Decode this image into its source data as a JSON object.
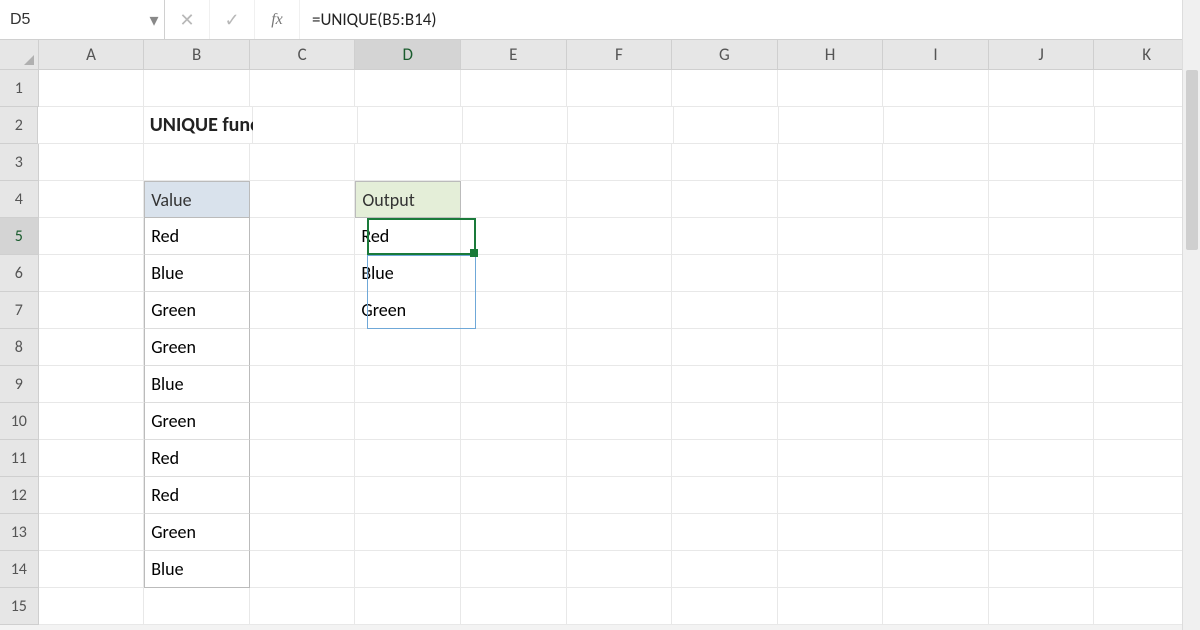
{
  "name_box": "D5",
  "formula": "=UNIQUE(B5:B14)",
  "columns": [
    "A",
    "B",
    "C",
    "D",
    "E",
    "F",
    "G",
    "H",
    "I",
    "J",
    "K"
  ],
  "active_col": "D",
  "active_row": 5,
  "row_numbers": [
    1,
    2,
    3,
    4,
    5,
    6,
    7,
    8,
    9,
    10,
    11,
    12,
    13,
    14,
    15
  ],
  "title": "UNIQUE function",
  "value_header": "Value",
  "values": [
    "Red",
    "Blue",
    "Green",
    "Green",
    "Blue",
    "Green",
    "Red",
    "Red",
    "Green",
    "Blue"
  ],
  "output_header": "Output",
  "output": [
    "Red",
    "Blue",
    "Green"
  ],
  "icons": {
    "dropdown": "▾",
    "cancel": "✕",
    "enter": "✓",
    "fx": "fx"
  }
}
